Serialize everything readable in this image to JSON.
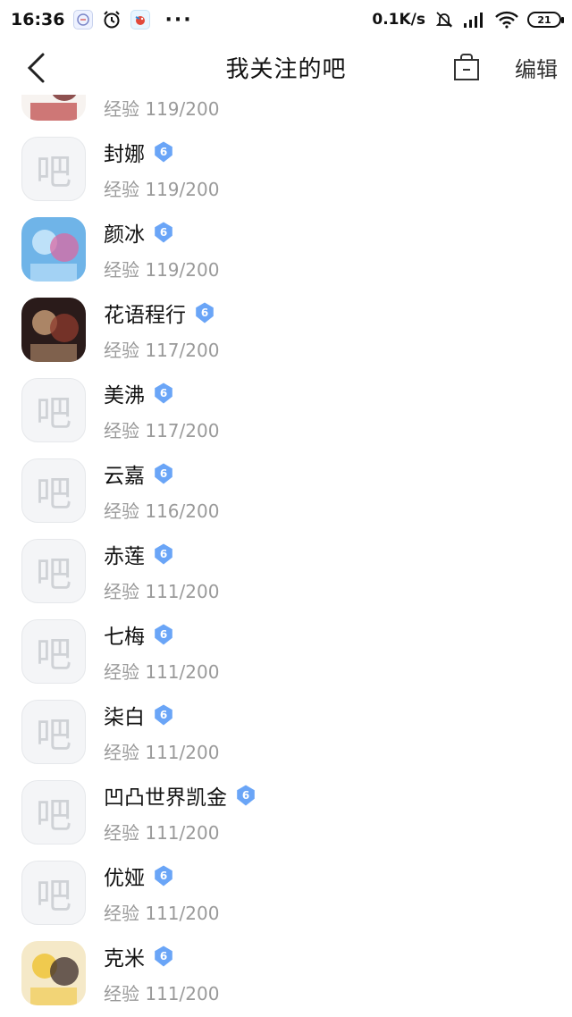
{
  "status_bar": {
    "time": "16:36",
    "net_speed": "0.1K/s",
    "battery": "21",
    "more": "···"
  },
  "nav": {
    "title": "我关注的吧",
    "edit_label": "编辑"
  },
  "default_avatar_glyph": "吧",
  "exp_prefix": "经验",
  "accent_color": "#6aa5f7",
  "bars": [
    {
      "name": "",
      "level": "6",
      "exp": "119/200",
      "avatar": "image-1"
    },
    {
      "name": "封娜",
      "level": "6",
      "exp": "119/200",
      "avatar": "default"
    },
    {
      "name": "颜冰",
      "level": "6",
      "exp": "119/200",
      "avatar": "image-2"
    },
    {
      "name": "花语程行",
      "level": "6",
      "exp": "117/200",
      "avatar": "image-3"
    },
    {
      "name": "美沸",
      "level": "6",
      "exp": "117/200",
      "avatar": "default"
    },
    {
      "name": "云嘉",
      "level": "6",
      "exp": "116/200",
      "avatar": "default"
    },
    {
      "name": "赤莲",
      "level": "6",
      "exp": "111/200",
      "avatar": "default"
    },
    {
      "name": "七梅",
      "level": "6",
      "exp": "111/200",
      "avatar": "default"
    },
    {
      "name": "柒白",
      "level": "6",
      "exp": "111/200",
      "avatar": "default"
    },
    {
      "name": "凹凸世界凯金",
      "level": "6",
      "exp": "111/200",
      "avatar": "default"
    },
    {
      "name": "优娅",
      "level": "6",
      "exp": "111/200",
      "avatar": "default"
    },
    {
      "name": "克米",
      "level": "6",
      "exp": "111/200",
      "avatar": "image-4"
    }
  ]
}
